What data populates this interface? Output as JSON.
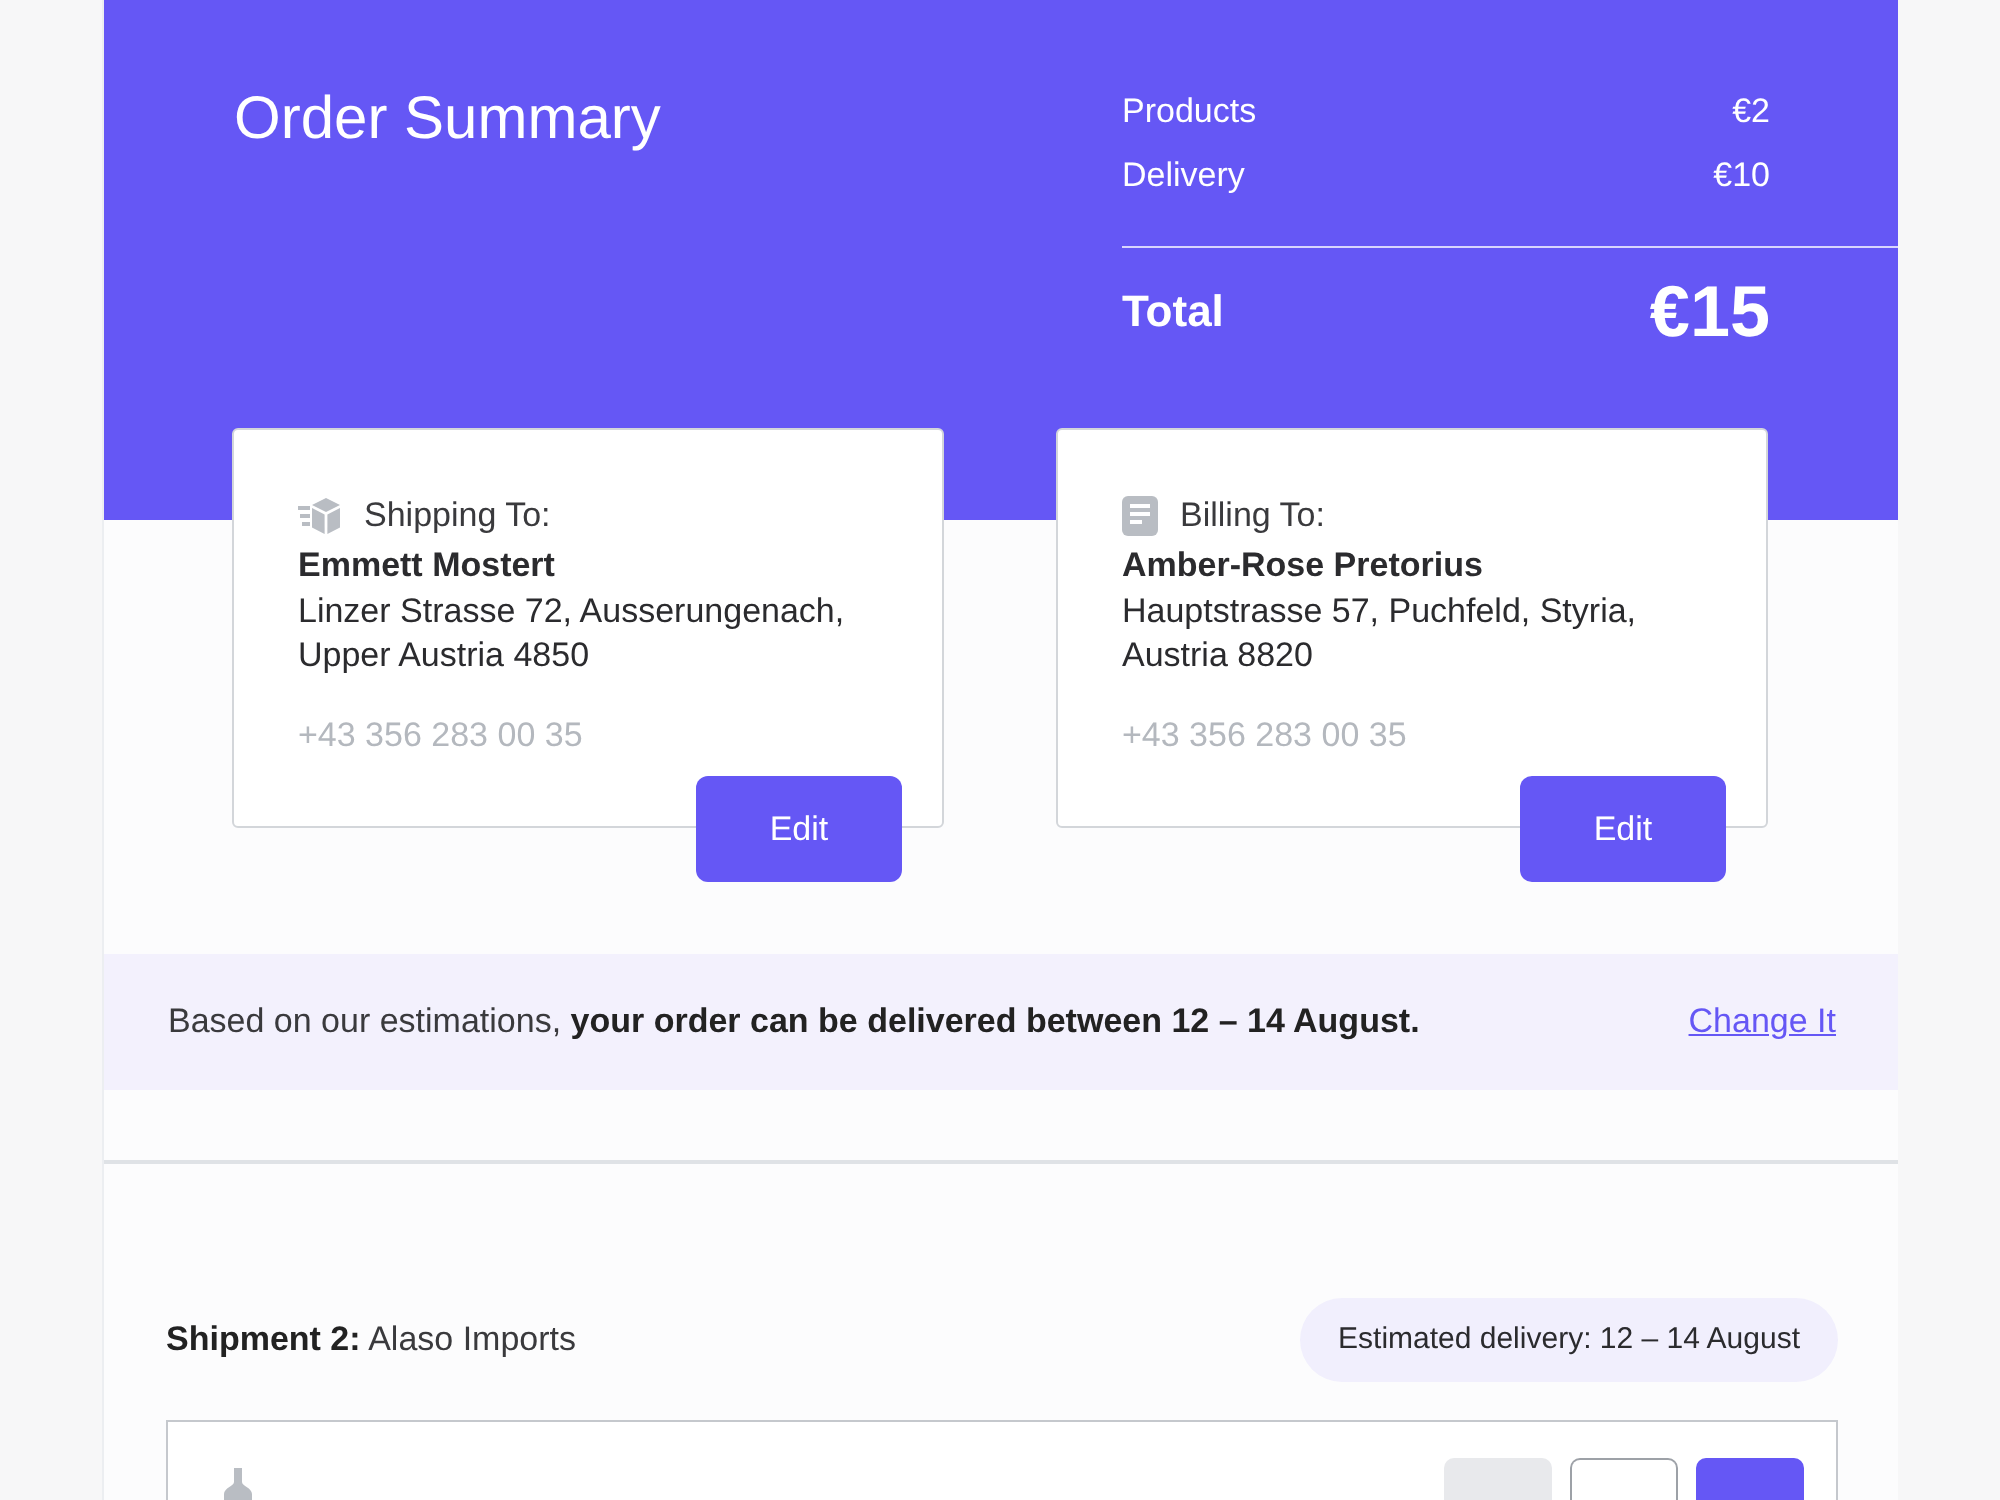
{
  "header": {
    "title": "Order Summary",
    "lines": [
      {
        "label": "Products",
        "amount": "€2"
      },
      {
        "label": "Delivery",
        "amount": "€10"
      }
    ],
    "total": {
      "label": "Total",
      "amount": "€15"
    }
  },
  "addresses": [
    {
      "kind": "shipping",
      "heading": "Shipping To:",
      "name": "Emmett Mostert",
      "address": "Linzer Strasse 72, Ausserungenach, Upper Austria 4850",
      "phone": "+43 356 283 00 35",
      "button": "Edit"
    },
    {
      "kind": "billing",
      "heading": "Billing To:",
      "name": "Amber-Rose Pretorius",
      "address": "Hauptstrasse 57, Puchfeld, Styria, Austria 8820",
      "phone": "+43 356 283 00 35",
      "button": "Edit"
    }
  ],
  "delivery_notice": {
    "text": "Based on our estimations, **your order can be delivered between 12 – 14 August.**",
    "link": "Change It"
  },
  "shipment": {
    "heading": "**Shipment 2:** Alaso Imports",
    "estimate": "Estimated delivery: 12 – 14 August"
  }
}
